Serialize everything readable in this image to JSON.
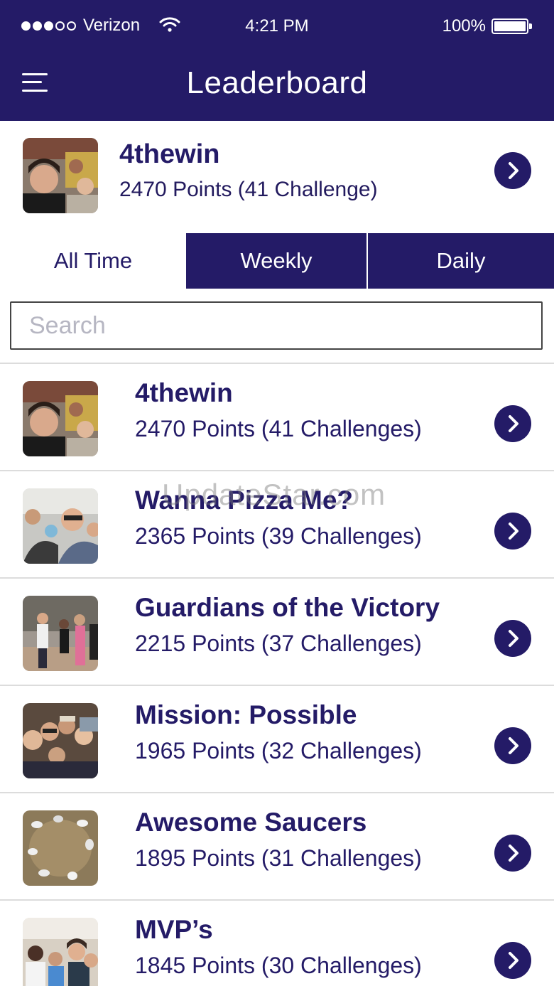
{
  "status_bar": {
    "carrier": "Verizon",
    "time": "4:21 PM",
    "battery": "100%",
    "signal_icon": "signal-dots-icon",
    "wifi_icon": "wifi-icon",
    "battery_icon": "battery-icon"
  },
  "header": {
    "title": "Leaderboard",
    "menu_icon": "hamburger-menu-icon"
  },
  "colors": {
    "brand": "#241b67",
    "background": "#ffffff",
    "divider": "#dcdcdc"
  },
  "my_team": {
    "name": "4thewin",
    "points": "2470 Points (41 Challenge)",
    "chevron_icon": "chevron-right-icon"
  },
  "tabs": [
    {
      "label": "All Time",
      "selected": true
    },
    {
      "label": "Weekly",
      "selected": false
    },
    {
      "label": "Daily",
      "selected": false
    }
  ],
  "search": {
    "placeholder": "Search",
    "value": ""
  },
  "teams": [
    {
      "name": "4thewin",
      "points": "2470 Points (41 Challenges)"
    },
    {
      "name": "Wanna Pizza Me?",
      "points": "2365 Points (39 Challenges)"
    },
    {
      "name": "Guardians of the Victory",
      "points": "2215 Points (37 Challenges)"
    },
    {
      "name": "Mission: Possible",
      "points": "1965 Points (32 Challenges)"
    },
    {
      "name": "Awesome Saucers",
      "points": "1895 Points (31 Challenges)"
    },
    {
      "name": "MVP’s",
      "points": "1845 Points (30 Challenges)"
    }
  ],
  "watermark": "UpdateStar.com"
}
